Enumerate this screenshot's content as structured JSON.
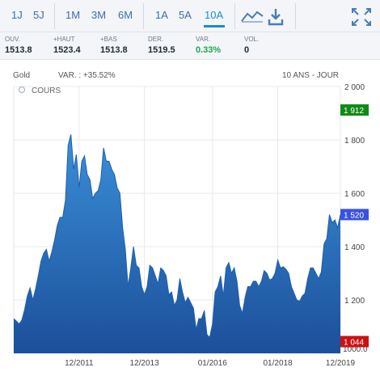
{
  "toolbar": {
    "ranges": [
      {
        "label": "1J",
        "active": false
      },
      {
        "label": "5J",
        "active": false
      },
      {
        "label": "1M",
        "active": false
      },
      {
        "label": "3M",
        "active": false
      },
      {
        "label": "6M",
        "active": false
      },
      {
        "label": "1A",
        "active": false
      },
      {
        "label": "5A",
        "active": false
      },
      {
        "label": "10A",
        "active": true
      }
    ],
    "icons": [
      "line-chart-icon",
      "download-icon",
      "fullscreen-icon"
    ]
  },
  "stats": [
    {
      "label": "OUV.",
      "value": "1513.8"
    },
    {
      "label": "+HAUT",
      "value": "1523.4"
    },
    {
      "label": "+BAS",
      "value": "1513.8"
    },
    {
      "label": "DER.",
      "value": "1519.5"
    },
    {
      "label": "VAR.",
      "value": "0.33%"
    },
    {
      "label": "VOL.",
      "value": "0"
    }
  ],
  "chart_header": {
    "instrument": "Gold",
    "variation": "VAR. : +35.52%",
    "period": "10 ANS - JOUR",
    "series_label": "COURS"
  },
  "colors": {
    "area_top": "#3a8fd8",
    "area_bottom": "#1c4f9a",
    "last_tag": "#3a52e0",
    "high_tag": "#118a17",
    "low_tag": "#cc1111",
    "positive": "#19a84b"
  },
  "chart_data": {
    "type": "area",
    "ylim": [
      1000,
      2000
    ],
    "yticks": [
      1200,
      1400,
      1600,
      1800,
      2000
    ],
    "ytick_labels": [
      "1 200",
      "1 400",
      "1 600",
      "1 800",
      "2 000"
    ],
    "ymin_label": "1000.0",
    "xticks": [
      "12/2011",
      "12/2013",
      "01/2016",
      "01/2018",
      "12/2019"
    ],
    "tags": {
      "high": "1 912",
      "last": "1 520",
      "low": "1 044"
    },
    "series": [
      {
        "x": [
          "2009-12",
          "2010-01",
          "2010-02",
          "2010-03",
          "2010-04",
          "2010-05",
          "2010-06",
          "2010-07",
          "2010-08",
          "2010-09",
          "2010-10",
          "2010-11",
          "2010-12",
          "2011-01",
          "2011-02",
          "2011-03",
          "2011-04",
          "2011-05",
          "2011-06",
          "2011-07",
          "2011-08",
          "2011-09",
          "2011-10",
          "2011-11",
          "2011-12",
          "2012-01",
          "2012-02",
          "2012-03",
          "2012-04",
          "2012-05",
          "2012-06",
          "2012-07",
          "2012-08",
          "2012-09",
          "2012-10",
          "2012-11",
          "2012-12",
          "2013-01",
          "2013-02",
          "2013-03",
          "2013-04",
          "2013-05",
          "2013-06",
          "2013-07",
          "2013-08",
          "2013-09",
          "2013-10",
          "2013-11",
          "2013-12",
          "2014-01",
          "2014-02",
          "2014-03",
          "2014-04",
          "2014-05",
          "2014-06",
          "2014-07",
          "2014-08",
          "2014-09",
          "2014-10",
          "2014-11",
          "2014-12",
          "2015-01",
          "2015-02",
          "2015-03",
          "2015-04",
          "2015-05",
          "2015-06",
          "2015-07",
          "2015-08",
          "2015-09",
          "2015-10",
          "2015-11",
          "2015-12",
          "2016-01",
          "2016-02",
          "2016-03",
          "2016-04",
          "2016-05",
          "2016-06",
          "2016-07",
          "2016-08",
          "2016-09",
          "2016-10",
          "2016-11",
          "2016-12",
          "2017-01",
          "2017-02",
          "2017-03",
          "2017-04",
          "2017-05",
          "2017-06",
          "2017-07",
          "2017-08",
          "2017-09",
          "2017-10",
          "2017-11",
          "2017-12",
          "2018-01",
          "2018-02",
          "2018-03",
          "2018-04",
          "2018-05",
          "2018-06",
          "2018-07",
          "2018-08",
          "2018-09",
          "2018-10",
          "2018-11",
          "2018-12",
          "2019-01",
          "2019-02",
          "2019-03",
          "2019-04",
          "2019-05",
          "2019-06",
          "2019-07",
          "2019-08",
          "2019-09",
          "2019-10",
          "2019-11",
          "2019-12"
        ],
        "values": [
          1130,
          1120,
          1110,
          1125,
          1165,
          1215,
          1245,
          1200,
          1240,
          1290,
          1345,
          1375,
          1390,
          1345,
          1380,
          1425,
          1480,
          1510,
          1510,
          1575,
          1780,
          1820,
          1690,
          1745,
          1620,
          1720,
          1740,
          1670,
          1650,
          1580,
          1600,
          1610,
          1650,
          1770,
          1720,
          1720,
          1690,
          1670,
          1620,
          1600,
          1470,
          1390,
          1250,
          1320,
          1400,
          1330,
          1320,
          1250,
          1220,
          1250,
          1330,
          1320,
          1290,
          1260,
          1320,
          1310,
          1290,
          1220,
          1230,
          1180,
          1200,
          1280,
          1230,
          1190,
          1210,
          1190,
          1170,
          1090,
          1130,
          1130,
          1160,
          1070,
          1060,
          1110,
          1230,
          1250,
          1290,
          1215,
          1320,
          1340,
          1300,
          1320,
          1270,
          1180,
          1150,
          1210,
          1250,
          1250,
          1270,
          1270,
          1250,
          1270,
          1310,
          1300,
          1275,
          1280,
          1300,
          1350,
          1320,
          1325,
          1315,
          1300,
          1250,
          1225,
          1200,
          1195,
          1215,
          1225,
          1280,
          1320,
          1320,
          1300,
          1280,
          1305,
          1410,
          1430,
          1520,
          1490,
          1500,
          1470,
          1520
        ]
      }
    ]
  }
}
